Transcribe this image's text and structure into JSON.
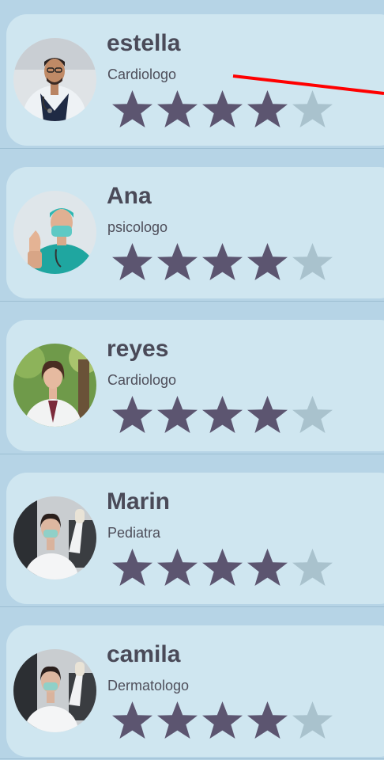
{
  "doctors": [
    {
      "name": "estella",
      "specialty": "Cardiologo",
      "rating": 4,
      "max_rating": 5,
      "avatar_icon": "doctor-with-stethoscope-photo"
    },
    {
      "name": "Ana",
      "specialty": "psicologo",
      "rating": 4,
      "max_rating": 5,
      "avatar_icon": "surgeon-thumbs-up-photo"
    },
    {
      "name": "reyes",
      "specialty": "Cardiologo",
      "rating": 4,
      "max_rating": 5,
      "avatar_icon": "doctor-in-park-photo"
    },
    {
      "name": "Marin",
      "specialty": "Pediatra",
      "rating": 4,
      "max_rating": 5,
      "avatar_icon": "doctor-with-mask-waving-photo"
    },
    {
      "name": "camila",
      "specialty": "Dermatologo",
      "rating": 4,
      "max_rating": 5,
      "avatar_icon": "doctor-with-mask-waving-photo"
    }
  ],
  "colors": {
    "background": "#b6d4e6",
    "card": "#cfe6f0",
    "star_filled": "#5c5570",
    "star_empty": "#a9c2cd",
    "annotation_arrow": "#ff0000"
  }
}
